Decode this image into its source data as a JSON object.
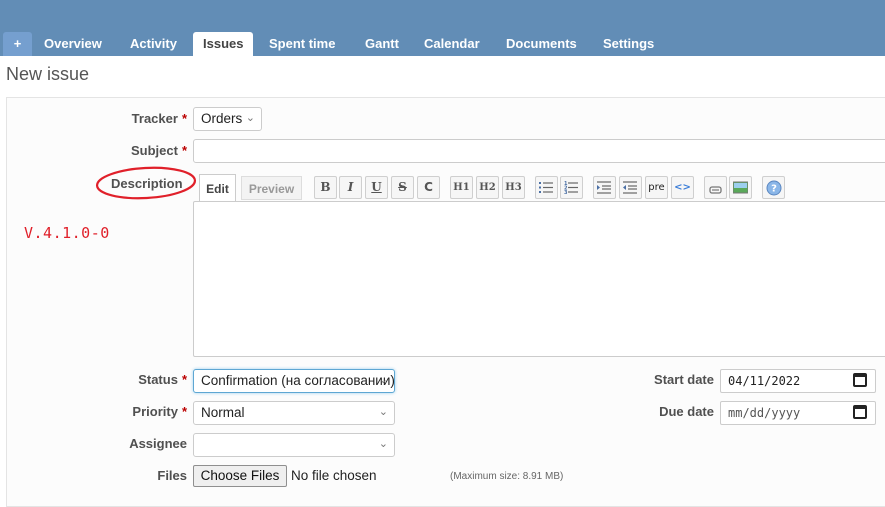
{
  "tabs": {
    "plus": "+",
    "items": [
      "Overview",
      "Activity",
      "Issues",
      "Spent time",
      "Gantt",
      "Calendar",
      "Documents",
      "Settings"
    ]
  },
  "page_title": "New issue",
  "form": {
    "tracker": {
      "label": "Tracker",
      "required": "*",
      "value": "Orders"
    },
    "subject": {
      "label": "Subject",
      "required": "*",
      "value": ""
    },
    "description": {
      "label": "Description",
      "tabs": [
        "Edit",
        "Preview"
      ],
      "toolbar": [
        "bold-icon",
        "italic-icon",
        "underline-icon",
        "strikethrough-icon",
        "code-icon",
        "heading1-icon",
        "heading2-icon",
        "heading3-icon",
        "unordered-list-icon",
        "ordered-list-icon",
        "quote-icon",
        "unquote-icon",
        "preformatted-icon",
        "code-highlight-icon",
        "link-icon",
        "image-icon",
        "help-icon"
      ],
      "toolbar_labels": {
        "bold": "B",
        "italic": "I",
        "underline": "U",
        "strike": "S",
        "code": "C",
        "h1": "H1",
        "h2": "H2",
        "h3": "H3",
        "pre": "pre",
        "codehl": "<>"
      }
    },
    "status": {
      "label": "Status",
      "required": "*",
      "value": "Confirmation (на согласовании)"
    },
    "priority": {
      "label": "Priority",
      "required": "*",
      "value": "Normal"
    },
    "assignee": {
      "label": "Assignee",
      "value": ""
    },
    "start_date": {
      "label": "Start date",
      "value": "04/11/2022"
    },
    "due_date": {
      "label": "Due date",
      "value": "mm/dd/yyyy"
    },
    "files": {
      "label": "Files",
      "button": "Choose Files",
      "status": "No file chosen",
      "max_size": "(Maximum size: 8.91 MB)"
    }
  },
  "annotation": {
    "version": "V.4.1.0-0",
    "highlight_color": "#e0202a"
  },
  "colors": {
    "header": "#628db6",
    "accent": "#759fcf",
    "required": "#bb0000"
  }
}
